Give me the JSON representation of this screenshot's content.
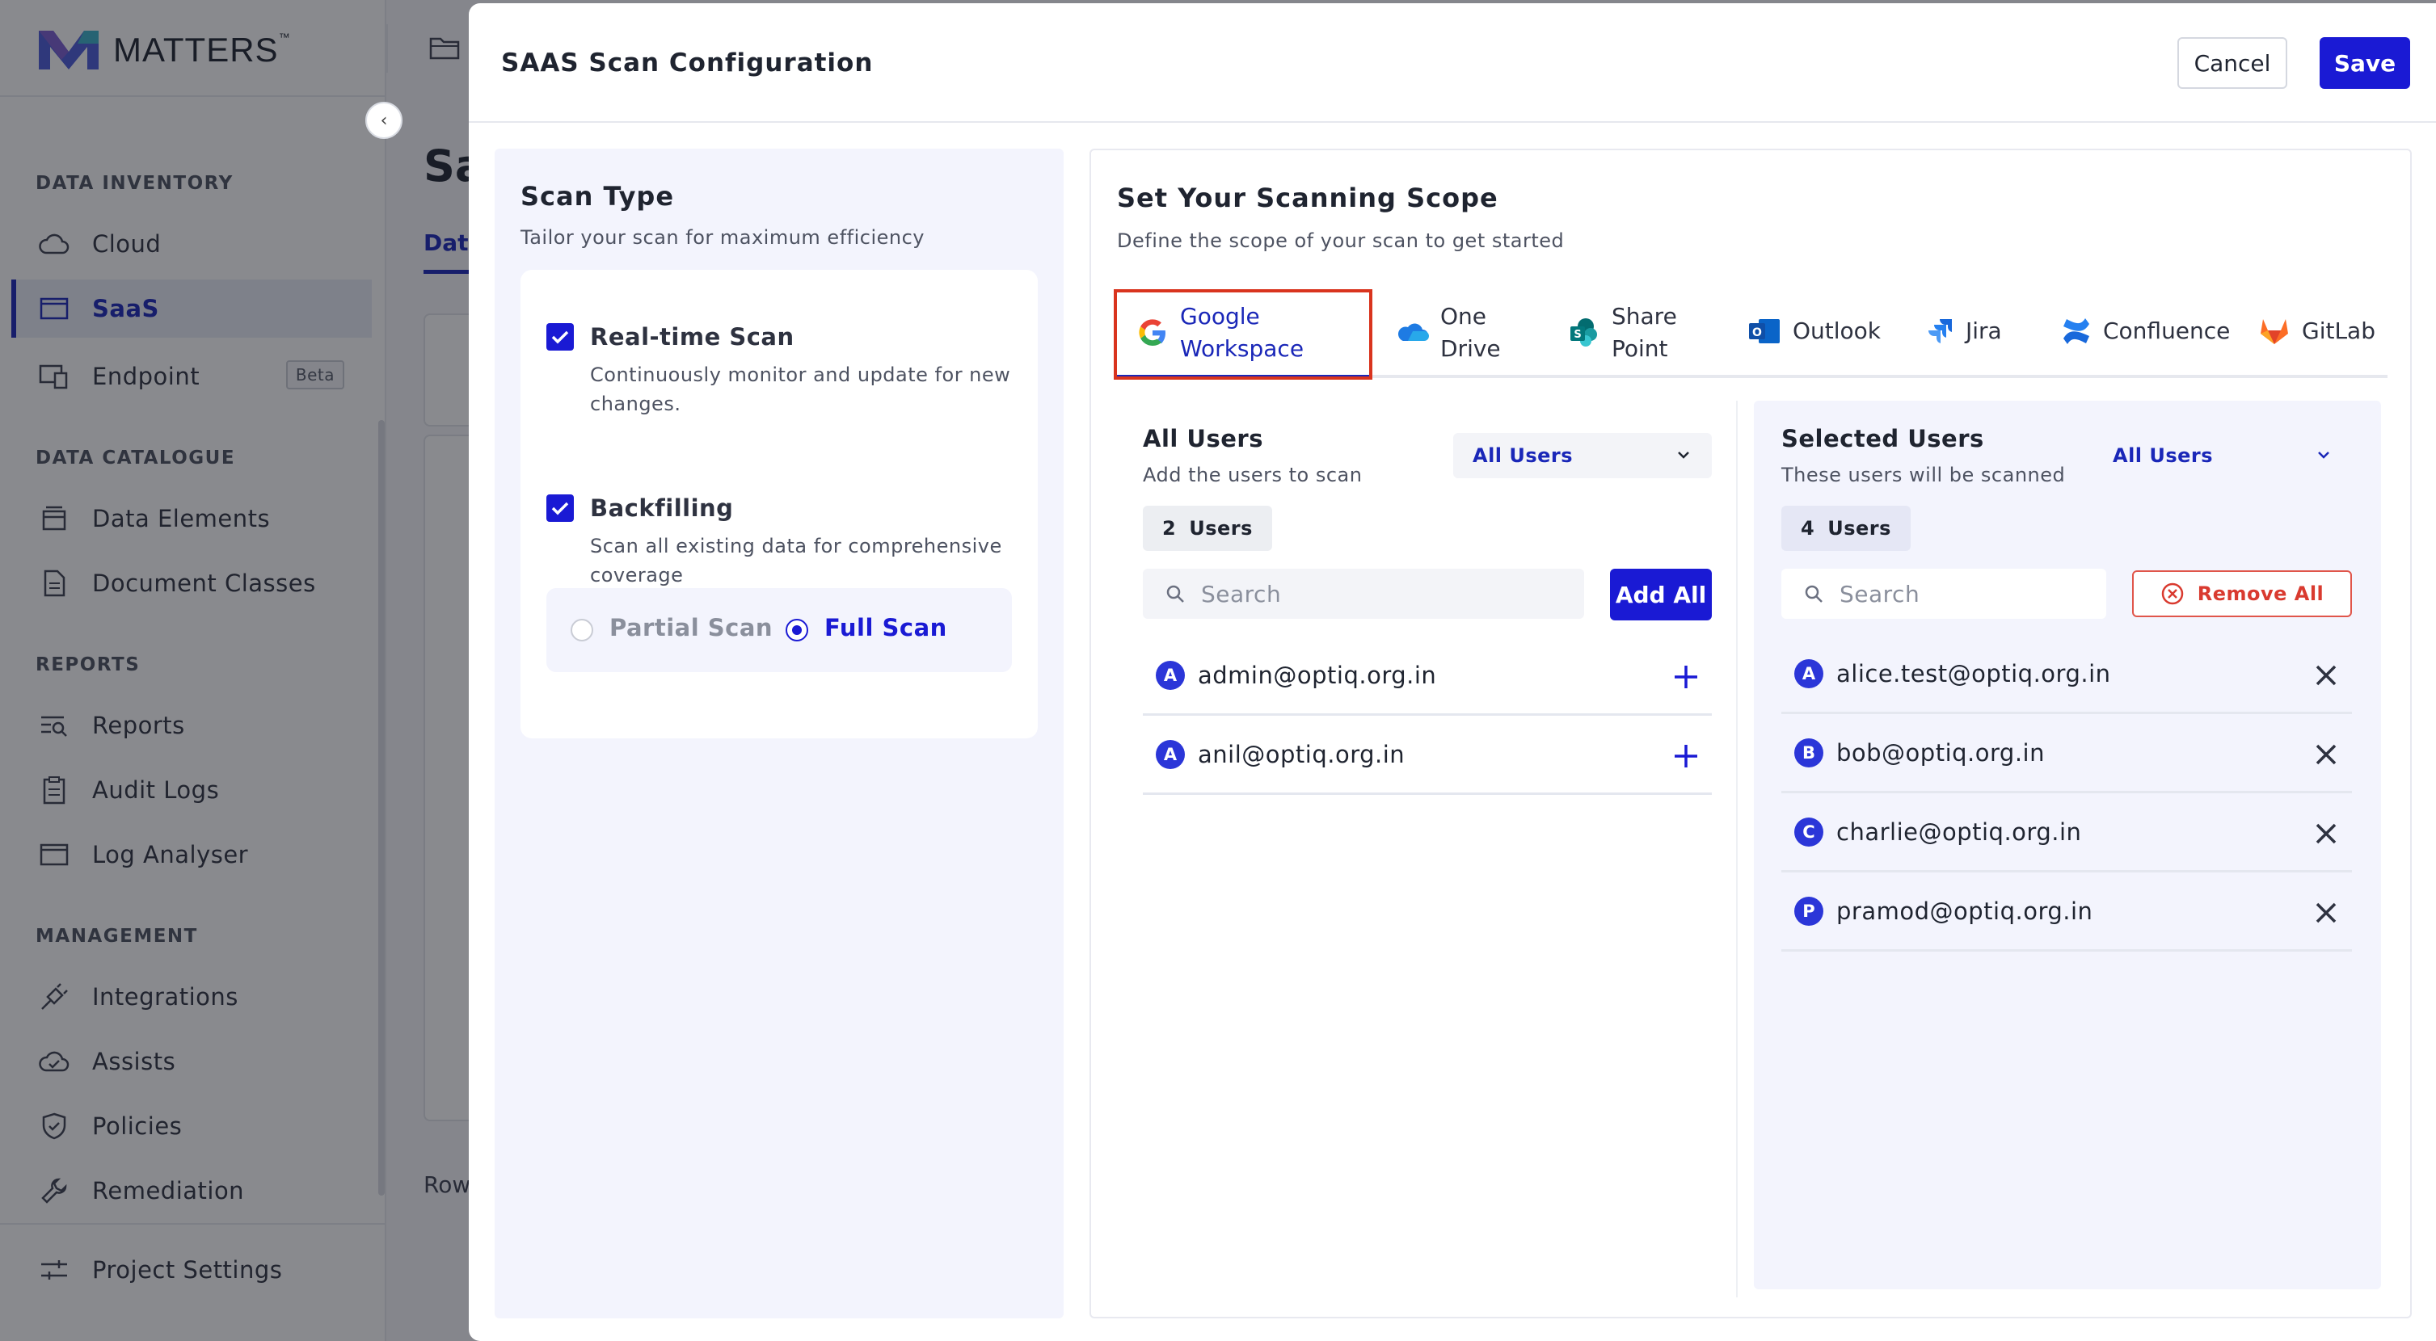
{
  "app": {
    "logo_text": "MATTERS",
    "logo_tm": "™"
  },
  "sidebar": {
    "sections": [
      {
        "title": "DATA INVENTORY"
      },
      {
        "title": "DATA CATALOGUE"
      },
      {
        "title": "REPORTS"
      },
      {
        "title": "MANAGEMENT"
      }
    ],
    "items": [
      {
        "label": "Cloud",
        "icon": "cloud-icon"
      },
      {
        "label": "SaaS",
        "icon": "saas-window-icon",
        "active": true
      },
      {
        "label": "Endpoint",
        "icon": "endpoint-devices-icon",
        "badge": "Beta"
      },
      {
        "label": "Data Elements",
        "icon": "database-icon"
      },
      {
        "label": "Document Classes",
        "icon": "document-icon"
      },
      {
        "label": "Reports",
        "icon": "report-search-icon"
      },
      {
        "label": "Audit Logs",
        "icon": "clipboard-icon"
      },
      {
        "label": "Log Analyser",
        "icon": "window-icon"
      },
      {
        "label": "Integrations",
        "icon": "plug-icon"
      },
      {
        "label": "Assists",
        "icon": "cloud-check-icon"
      },
      {
        "label": "Policies",
        "icon": "shield-check-icon"
      },
      {
        "label": "Remediation",
        "icon": "wrench-icon"
      }
    ],
    "footer_item": {
      "label": "Project Settings",
      "icon": "sliders-icon"
    }
  },
  "background_page": {
    "title_fragment": "Sa",
    "tab_fragment": "Data",
    "rows_fragment": "Row"
  },
  "modal": {
    "title": "SAAS Scan Configuration",
    "cancel_label": "Cancel",
    "save_label": "Save",
    "scan_type": {
      "title": "Scan Type",
      "subtitle": "Tailor your scan for maximum efficiency",
      "realtime": {
        "label": "Real-time Scan",
        "description": "Continuously monitor and update for new changes.",
        "checked": true
      },
      "backfilling": {
        "label": "Backfilling",
        "description": "Scan all existing data for comprehensive coverage",
        "checked": true
      },
      "modes": [
        {
          "label": "Partial Scan",
          "selected": false
        },
        {
          "label": "Full Scan",
          "selected": true
        }
      ]
    },
    "scope": {
      "title": "Set Your Scanning Scope",
      "subtitle": "Define the scope of your scan to get started",
      "tabs": [
        {
          "label_line1": "Google",
          "label_line2": "Workspace",
          "icon": "google-icon",
          "active": true
        },
        {
          "label_line1": "One",
          "label_line2": "Drive",
          "icon": "onedrive-icon"
        },
        {
          "label_line1": "Share",
          "label_line2": "Point",
          "icon": "sharepoint-icon"
        },
        {
          "label_line1": "Outlook",
          "icon": "outlook-icon"
        },
        {
          "label_line1": "Jira",
          "icon": "jira-icon"
        },
        {
          "label_line1": "Confluence",
          "icon": "confluence-icon"
        },
        {
          "label_line1": "GitLab",
          "icon": "gitlab-icon"
        }
      ],
      "all_users": {
        "title": "All Users",
        "subtitle": "Add the users to scan",
        "filter_value": "All Users",
        "count": "2",
        "count_unit": "Users",
        "search_placeholder": "Search",
        "add_all_label": "Add All",
        "users": [
          {
            "initial": "A",
            "email": "admin@optiq.org.in"
          },
          {
            "initial": "A",
            "email": "anil@optiq.org.in"
          }
        ]
      },
      "selected_users": {
        "title": "Selected Users",
        "subtitle": "These users will be scanned",
        "filter_value": "All Users",
        "count": "4",
        "count_unit": "Users",
        "search_placeholder": "Search",
        "remove_all_label": "Remove All",
        "users": [
          {
            "initial": "A",
            "email": "alice.test@optiq.org.in"
          },
          {
            "initial": "B",
            "email": "bob@optiq.org.in"
          },
          {
            "initial": "C",
            "email": "charlie@optiq.org.in"
          },
          {
            "initial": "P",
            "email": "pramod@optiq.org.in"
          }
        ]
      }
    }
  },
  "colors": {
    "accent": "#1a1ad4",
    "accent_text": "#1a27b8",
    "highlight_box": "#d9341e",
    "danger": "#d93a2f",
    "panel_bg": "#f3f4fd"
  }
}
